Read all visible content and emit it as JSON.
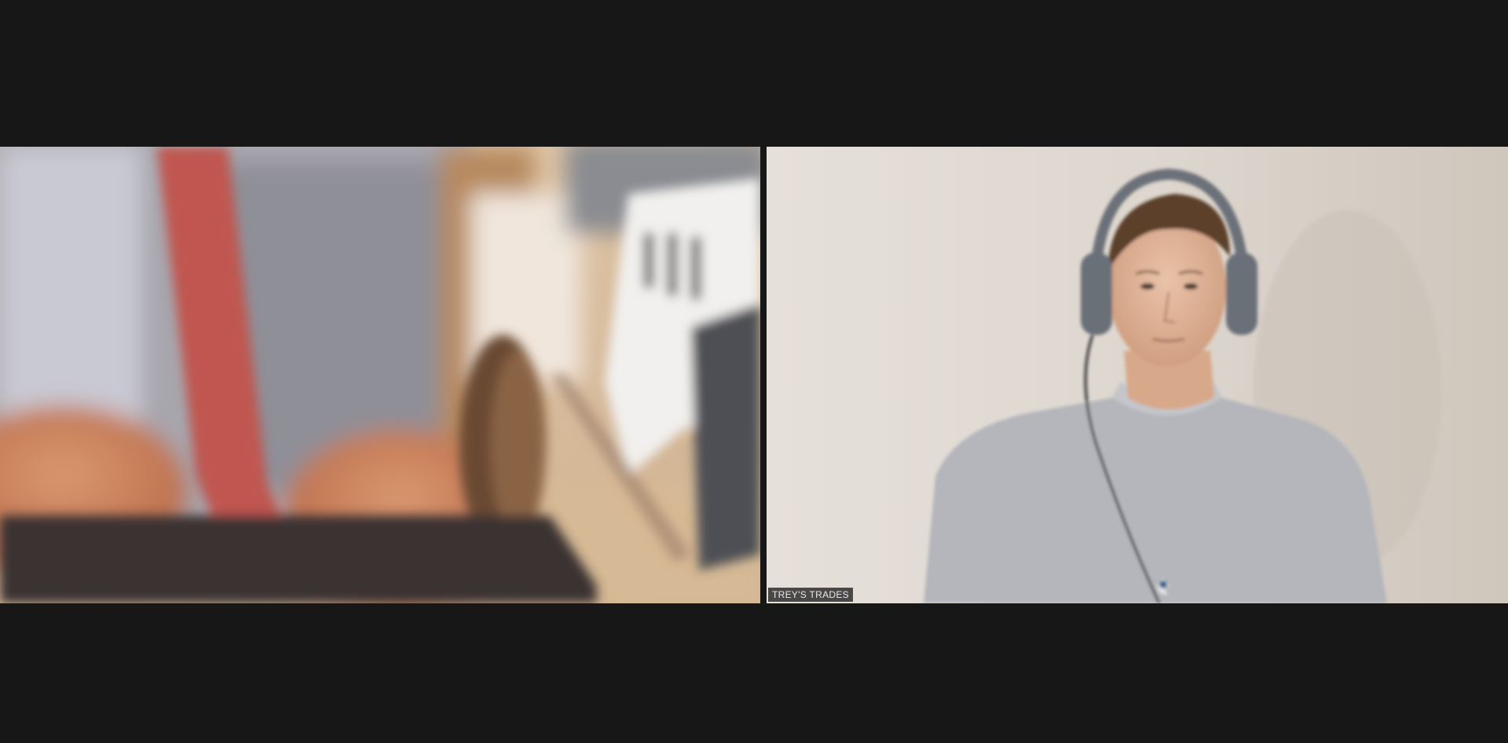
{
  "meeting": {
    "participants": [
      {
        "name": "",
        "video": "blurred-motion-feed"
      },
      {
        "name": "TREY'S TRADES",
        "video": "webcam-man-headphones"
      }
    ]
  },
  "colors": {
    "background": "#171717",
    "name_tag_bg": "#1e1e1e",
    "name_tag_text": "#e8e8e8"
  }
}
